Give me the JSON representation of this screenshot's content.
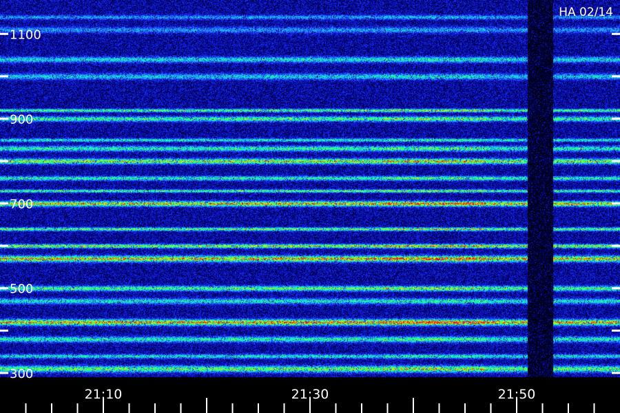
{
  "stamp": "HA 02/14",
  "chart_data": {
    "type": "heatmap",
    "title": "",
    "xlabel": "",
    "ylabel": "",
    "x_ticks": [
      "21:10",
      "21:30",
      "21:50"
    ],
    "x_tick_minutes": [
      10,
      30,
      50
    ],
    "x_range_minutes": [
      0,
      60
    ],
    "y_ticks": [
      300,
      500,
      700,
      900,
      1100
    ],
    "y_range": [
      290,
      1180
    ],
    "colormap": [
      "#000000",
      "#00007a",
      "#1a2cff",
      "#2aa0ff",
      "#00ffd0",
      "#40ff40",
      "#ffff00",
      "#ff0000"
    ],
    "bands": [
      {
        "y": 1140,
        "level": 0.3
      },
      {
        "y": 1110,
        "level": 0.28
      },
      {
        "y": 1040,
        "level": 0.42
      },
      {
        "y": 1000,
        "level": 0.38
      },
      {
        "y": 920,
        "level": 0.62
      },
      {
        "y": 900,
        "level": 0.55
      },
      {
        "y": 850,
        "level": 0.48
      },
      {
        "y": 830,
        "level": 0.52
      },
      {
        "y": 800,
        "level": 0.7
      },
      {
        "y": 760,
        "level": 0.52
      },
      {
        "y": 730,
        "level": 0.6
      },
      {
        "y": 700,
        "level": 0.8
      },
      {
        "y": 640,
        "level": 0.62
      },
      {
        "y": 600,
        "level": 0.72
      },
      {
        "y": 570,
        "level": 0.8
      },
      {
        "y": 500,
        "level": 0.6
      },
      {
        "y": 470,
        "level": 0.45
      },
      {
        "y": 420,
        "level": 0.82
      },
      {
        "y": 380,
        "level": 0.5
      },
      {
        "y": 340,
        "level": 0.45
      },
      {
        "y": 310,
        "level": 0.62
      }
    ],
    "activity_window_minutes": [
      37,
      47
    ],
    "gap_minutes": [
      51,
      53.5
    ]
  }
}
